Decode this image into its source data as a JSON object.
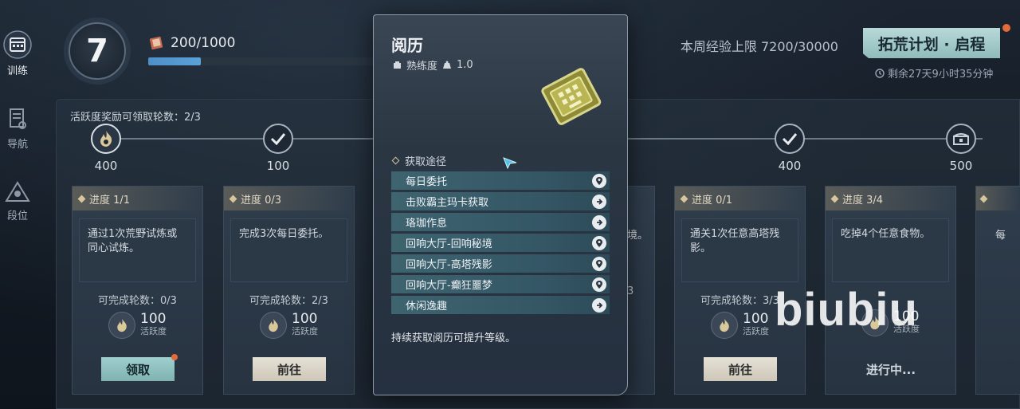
{
  "nav": {
    "items": [
      {
        "label": "训练",
        "icon": "calendar-icon",
        "active": true
      },
      {
        "label": "导航",
        "icon": "guide-book-icon",
        "active": false
      },
      {
        "label": "段位",
        "icon": "rank-icon",
        "active": false
      }
    ]
  },
  "header": {
    "level": "7",
    "xp": "200/1000",
    "xp_progress": 0.2,
    "weekly_cap": "本周经验上限 7200/30000",
    "plan_button": "拓荒计划 · 启程",
    "remaining": "剩余27天9小时35分钟"
  },
  "activity": {
    "reward_rounds": "活跃度奖励可领取轮数：2/3",
    "milestones": [
      {
        "value": "400",
        "icon": "flame-icon"
      },
      {
        "value": "100",
        "icon": "check-icon"
      },
      {
        "value": "",
        "icon": "check-icon"
      },
      {
        "value": "400",
        "icon": "check-icon"
      },
      {
        "value": "500",
        "icon": "chest-icon"
      }
    ]
  },
  "cards": [
    {
      "progress": "进度 1/1",
      "desc": "通过1次荒野试炼或同心试炼。",
      "rounds": "可完成轮数：0/3",
      "reward": "100",
      "unit": "活跃度",
      "button": "领取",
      "button_type": "claim",
      "has_dot": true
    },
    {
      "progress": "进度 0/3",
      "desc": "完成3次每日委托。",
      "rounds": "可完成轮数：2/3",
      "reward": "100",
      "unit": "活跃度",
      "button": "前往",
      "button_type": "go",
      "has_dot": false
    },
    {
      "progress": "进度 0/1",
      "desc": "通关1次任意高塔残影。",
      "rounds": "可完成轮数：3/3",
      "reward": "100",
      "unit": "活跃度",
      "button": "前往",
      "button_type": "go",
      "has_dot": false
    },
    {
      "progress": "进度 3/4",
      "desc": "吃掉4个任意食物。",
      "rounds": "",
      "reward": "100",
      "unit": "活跃度",
      "button": "进行中...",
      "button_type": "progress",
      "has_dot": false
    }
  ],
  "hidden_card_fragments": {
    "card3_desc_tail": "境。",
    "card3_rounds_tail": "3",
    "card5_desc_head": "每"
  },
  "popup": {
    "title": "阅历",
    "meta_label": "熟练度",
    "meta_value": "1.0",
    "sources_title": "获取途径",
    "sources": [
      {
        "label": "每日委托",
        "icon": "location-pin-icon"
      },
      {
        "label": "击败霸主玛卡获取",
        "icon": "arrow-right-icon"
      },
      {
        "label": "珞珈作息",
        "icon": "arrow-right-icon"
      },
      {
        "label": "回响大厅-回响秘境",
        "icon": "location-pin-icon"
      },
      {
        "label": "回响大厅-高塔残影",
        "icon": "location-pin-icon"
      },
      {
        "label": "回响大厅-癫狂噩梦",
        "icon": "location-pin-icon"
      },
      {
        "label": "休闲逸趣",
        "icon": "arrow-right-icon"
      }
    ],
    "footer": "持续获取阅历可提升等级。"
  },
  "watermark": "biubiu",
  "colors": {
    "accent_teal": "#8fbcbb",
    "notify": "#e56a3a",
    "xp_fill": "#5aa2d8"
  }
}
